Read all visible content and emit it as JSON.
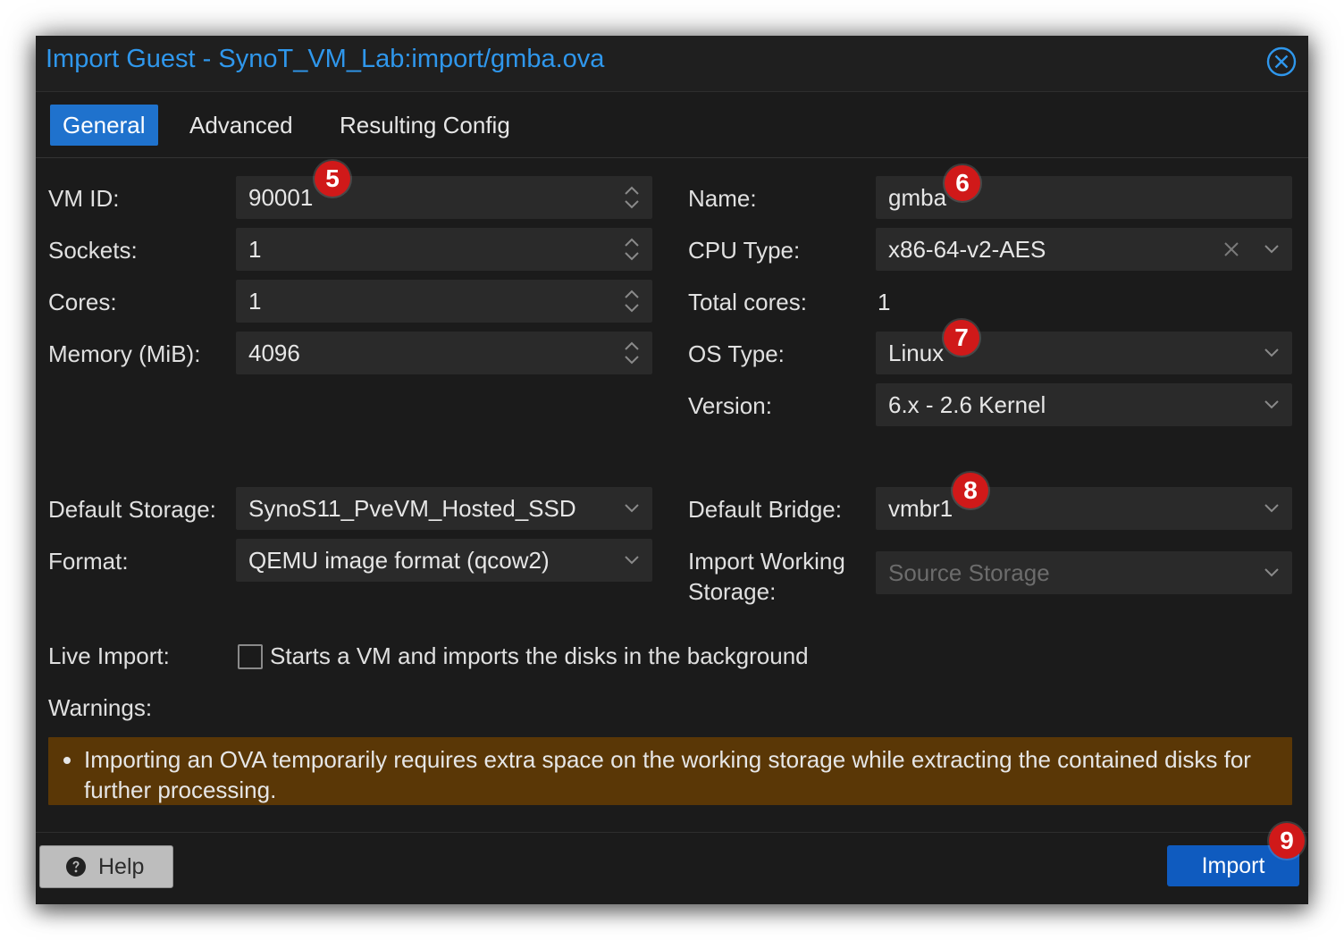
{
  "dialog": {
    "title": "Import Guest - SynoT_VM_Lab:import/gmba.ova",
    "close_icon": "close-circle-icon"
  },
  "tabs": [
    {
      "label": "General",
      "active": true
    },
    {
      "label": "Advanced",
      "active": false
    },
    {
      "label": "Resulting Config",
      "active": false
    }
  ],
  "left": {
    "vm_id": {
      "label": "VM ID:",
      "value": "90001"
    },
    "sockets": {
      "label": "Sockets:",
      "value": "1"
    },
    "cores": {
      "label": "Cores:",
      "value": "1"
    },
    "memory": {
      "label": "Memory (MiB):",
      "value": "4096"
    },
    "default_storage": {
      "label": "Default Storage:",
      "value": "SynoS11_PveVM_Hosted_SSD"
    },
    "format": {
      "label": "Format:",
      "value": "QEMU image format (qcow2)"
    }
  },
  "right": {
    "name": {
      "label": "Name:",
      "value": "gmba"
    },
    "cpu_type": {
      "label": "CPU Type:",
      "value": "x86-64-v2-AES"
    },
    "total_cores": {
      "label": "Total cores:",
      "value": "1"
    },
    "os_type": {
      "label": "OS Type:",
      "value": "Linux"
    },
    "version": {
      "label": "Version:",
      "value": "6.x - 2.6 Kernel"
    },
    "default_bridge": {
      "label": "Default Bridge:",
      "value": "vmbr1"
    },
    "import_working_storage": {
      "label_line1": "Import Working",
      "label_line2": "Storage:",
      "placeholder": "Source Storage"
    }
  },
  "live_import": {
    "label": "Live Import:",
    "checkbox_label": "Starts a VM and imports the disks in the background",
    "checked": false
  },
  "warnings": {
    "label": "Warnings:",
    "items": [
      "Importing an OVA temporarily requires extra space on the working storage while extracting the contained disks for further processing."
    ],
    "bg_color": "#5a3706"
  },
  "footer": {
    "help_label": "Help",
    "import_label": "Import"
  },
  "annotations": {
    "badge_5": "5",
    "badge_6": "6",
    "badge_7": "7",
    "badge_8": "8",
    "badge_9": "9",
    "color": "#d01919"
  },
  "colors": {
    "accent": "#1f72cd",
    "title": "#2f97ec",
    "import_button": "#0f5bbf"
  }
}
